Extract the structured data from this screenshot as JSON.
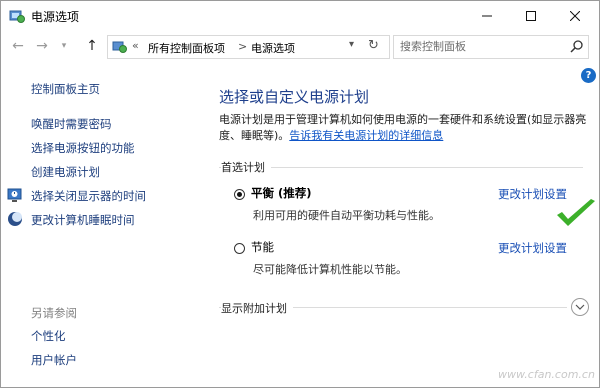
{
  "window": {
    "title": "电源选项"
  },
  "address": {
    "chevrons": "«",
    "crumbs": [
      "所有控制面板项",
      "电源选项"
    ],
    "separator": ">",
    "search_placeholder": "搜索控制面板"
  },
  "sidebar": {
    "home": "控制面板主页",
    "links": [
      "唤醒时需要密码",
      "选择电源按钮的功能",
      "创建电源计划",
      "选择关闭显示器的时间",
      "更改计算机睡眠时间"
    ],
    "see_also_title": "另请参阅",
    "see_also": [
      "个性化",
      "用户帐户"
    ]
  },
  "main": {
    "title": "选择或自定义电源计划",
    "description": "电源计划是用于管理计算机如何使用电源的一套硬件和系统设置(如显示器亮度、睡眠等)。",
    "learn_more": "告诉我有关电源计划的详细信息",
    "preferred_label": "首选计划",
    "plans": [
      {
        "name": "平衡 (推荐)",
        "description": "利用可用的硬件自动平衡功耗与性能。",
        "selected": true,
        "link": "更改计划设置"
      },
      {
        "name": "节能",
        "description": "尽可能降低计算机性能以节能。",
        "selected": false,
        "link": "更改计划设置"
      }
    ],
    "additional_label": "显示附加计划"
  },
  "help_glyph": "?",
  "watermark": "www.cfan.com.cn",
  "colors": {
    "link": "#1e3f7e",
    "title": "#1e3f8c",
    "check": "#3cb02a"
  }
}
